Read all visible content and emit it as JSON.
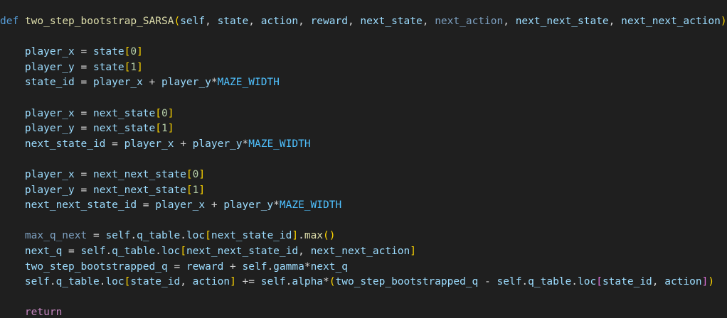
{
  "editor": {
    "language": "python",
    "colors": {
      "background": "#1f1f1f",
      "keyword": "#569cd6",
      "function": "#dcdcaa",
      "variable": "#9cdcfe",
      "constant": "#4fc1ff",
      "number": "#b5cea8",
      "bracket_level1": "#ffd700",
      "bracket_level2": "#da70d6",
      "bracket_level3": "#179fff",
      "control": "#c586c0",
      "text": "#d4d4d4"
    },
    "lines": [
      {
        "tokens": [
          {
            "t": "def",
            "c": "kw"
          },
          {
            "t": " ",
            "c": "plain"
          },
          {
            "t": "two_step_bootstrap_SARSA",
            "c": "fn"
          },
          {
            "t": "(",
            "c": "br1"
          },
          {
            "t": "self",
            "c": "param"
          },
          {
            "t": ", ",
            "c": "plain"
          },
          {
            "t": "state",
            "c": "param"
          },
          {
            "t": ", ",
            "c": "plain"
          },
          {
            "t": "action",
            "c": "param"
          },
          {
            "t": ", ",
            "c": "plain"
          },
          {
            "t": "reward",
            "c": "param"
          },
          {
            "t": ", ",
            "c": "plain"
          },
          {
            "t": "next_state",
            "c": "param"
          },
          {
            "t": ", ",
            "c": "plain"
          },
          {
            "t": "next_action",
            "c": "param-dim"
          },
          {
            "t": ", ",
            "c": "plain"
          },
          {
            "t": "next_next_state",
            "c": "param"
          },
          {
            "t": ", ",
            "c": "plain"
          },
          {
            "t": "next_next_action",
            "c": "param"
          },
          {
            "t": ")",
            "c": "br1"
          },
          {
            "t": ":",
            "c": "plain"
          }
        ]
      },
      {
        "tokens": []
      },
      {
        "tokens": [
          {
            "t": "    ",
            "c": "plain"
          },
          {
            "t": "player_x",
            "c": "var"
          },
          {
            "t": " = ",
            "c": "op"
          },
          {
            "t": "state",
            "c": "var"
          },
          {
            "t": "[",
            "c": "br1"
          },
          {
            "t": "0",
            "c": "num"
          },
          {
            "t": "]",
            "c": "br1"
          }
        ]
      },
      {
        "tokens": [
          {
            "t": "    ",
            "c": "plain"
          },
          {
            "t": "player_y",
            "c": "var"
          },
          {
            "t": " = ",
            "c": "op"
          },
          {
            "t": "state",
            "c": "var"
          },
          {
            "t": "[",
            "c": "br1"
          },
          {
            "t": "1",
            "c": "num"
          },
          {
            "t": "]",
            "c": "br1"
          }
        ]
      },
      {
        "tokens": [
          {
            "t": "    ",
            "c": "plain"
          },
          {
            "t": "state_id",
            "c": "var"
          },
          {
            "t": " = ",
            "c": "op"
          },
          {
            "t": "player_x",
            "c": "var"
          },
          {
            "t": " + ",
            "c": "op"
          },
          {
            "t": "player_y",
            "c": "var"
          },
          {
            "t": "*",
            "c": "op"
          },
          {
            "t": "MAZE_WIDTH",
            "c": "const"
          }
        ]
      },
      {
        "tokens": []
      },
      {
        "tokens": [
          {
            "t": "    ",
            "c": "plain"
          },
          {
            "t": "player_x",
            "c": "var"
          },
          {
            "t": " = ",
            "c": "op"
          },
          {
            "t": "next_state",
            "c": "var"
          },
          {
            "t": "[",
            "c": "br1"
          },
          {
            "t": "0",
            "c": "num"
          },
          {
            "t": "]",
            "c": "br1"
          }
        ]
      },
      {
        "tokens": [
          {
            "t": "    ",
            "c": "plain"
          },
          {
            "t": "player_y",
            "c": "var"
          },
          {
            "t": " = ",
            "c": "op"
          },
          {
            "t": "next_state",
            "c": "var"
          },
          {
            "t": "[",
            "c": "br1"
          },
          {
            "t": "1",
            "c": "num"
          },
          {
            "t": "]",
            "c": "br1"
          }
        ]
      },
      {
        "tokens": [
          {
            "t": "    ",
            "c": "plain"
          },
          {
            "t": "next_state_id",
            "c": "var"
          },
          {
            "t": " = ",
            "c": "op"
          },
          {
            "t": "player_x",
            "c": "var"
          },
          {
            "t": " + ",
            "c": "op"
          },
          {
            "t": "player_y",
            "c": "var"
          },
          {
            "t": "*",
            "c": "op"
          },
          {
            "t": "MAZE_WIDTH",
            "c": "const"
          }
        ]
      },
      {
        "tokens": []
      },
      {
        "tokens": [
          {
            "t": "    ",
            "c": "plain"
          },
          {
            "t": "player_x",
            "c": "var"
          },
          {
            "t": " = ",
            "c": "op"
          },
          {
            "t": "next_next_state",
            "c": "var"
          },
          {
            "t": "[",
            "c": "br1"
          },
          {
            "t": "0",
            "c": "num"
          },
          {
            "t": "]",
            "c": "br1"
          }
        ]
      },
      {
        "tokens": [
          {
            "t": "    ",
            "c": "plain"
          },
          {
            "t": "player_y",
            "c": "var"
          },
          {
            "t": " = ",
            "c": "op"
          },
          {
            "t": "next_next_state",
            "c": "var"
          },
          {
            "t": "[",
            "c": "br1"
          },
          {
            "t": "1",
            "c": "num"
          },
          {
            "t": "]",
            "c": "br1"
          }
        ]
      },
      {
        "tokens": [
          {
            "t": "    ",
            "c": "plain"
          },
          {
            "t": "next_next_state_id",
            "c": "var"
          },
          {
            "t": " = ",
            "c": "op"
          },
          {
            "t": "player_x",
            "c": "var"
          },
          {
            "t": " + ",
            "c": "op"
          },
          {
            "t": "player_y",
            "c": "var"
          },
          {
            "t": "*",
            "c": "op"
          },
          {
            "t": "MAZE_WIDTH",
            "c": "const"
          }
        ]
      },
      {
        "tokens": []
      },
      {
        "tokens": [
          {
            "t": "    ",
            "c": "plain"
          },
          {
            "t": "max_q_next",
            "c": "var-dim"
          },
          {
            "t": " = ",
            "c": "op"
          },
          {
            "t": "self",
            "c": "var"
          },
          {
            "t": ".",
            "c": "op"
          },
          {
            "t": "q_table",
            "c": "var"
          },
          {
            "t": ".",
            "c": "op"
          },
          {
            "t": "loc",
            "c": "var"
          },
          {
            "t": "[",
            "c": "br1"
          },
          {
            "t": "next_state_id",
            "c": "var"
          },
          {
            "t": "]",
            "c": "br1"
          },
          {
            "t": ".",
            "c": "op"
          },
          {
            "t": "max",
            "c": "fn"
          },
          {
            "t": "()",
            "c": "br1"
          }
        ]
      },
      {
        "tokens": [
          {
            "t": "    ",
            "c": "plain"
          },
          {
            "t": "next_q",
            "c": "var"
          },
          {
            "t": " = ",
            "c": "op"
          },
          {
            "t": "self",
            "c": "var"
          },
          {
            "t": ".",
            "c": "op"
          },
          {
            "t": "q_table",
            "c": "var"
          },
          {
            "t": ".",
            "c": "op"
          },
          {
            "t": "loc",
            "c": "var"
          },
          {
            "t": "[",
            "c": "br1"
          },
          {
            "t": "next_next_state_id",
            "c": "var"
          },
          {
            "t": ", ",
            "c": "plain"
          },
          {
            "t": "next_next_action",
            "c": "var"
          },
          {
            "t": "]",
            "c": "br1"
          }
        ]
      },
      {
        "tokens": [
          {
            "t": "    ",
            "c": "plain"
          },
          {
            "t": "two_step_bootstrapped_q",
            "c": "var"
          },
          {
            "t": " = ",
            "c": "op"
          },
          {
            "t": "reward",
            "c": "var"
          },
          {
            "t": " + ",
            "c": "op"
          },
          {
            "t": "self",
            "c": "var"
          },
          {
            "t": ".",
            "c": "op"
          },
          {
            "t": "gamma",
            "c": "var"
          },
          {
            "t": "*",
            "c": "op"
          },
          {
            "t": "next_q",
            "c": "var"
          }
        ]
      },
      {
        "tokens": [
          {
            "t": "    ",
            "c": "plain"
          },
          {
            "t": "self",
            "c": "var"
          },
          {
            "t": ".",
            "c": "op"
          },
          {
            "t": "q_table",
            "c": "var"
          },
          {
            "t": ".",
            "c": "op"
          },
          {
            "t": "loc",
            "c": "var"
          },
          {
            "t": "[",
            "c": "br1"
          },
          {
            "t": "state_id",
            "c": "var"
          },
          {
            "t": ", ",
            "c": "plain"
          },
          {
            "t": "action",
            "c": "var"
          },
          {
            "t": "]",
            "c": "br1"
          },
          {
            "t": " += ",
            "c": "op"
          },
          {
            "t": "self",
            "c": "var"
          },
          {
            "t": ".",
            "c": "op"
          },
          {
            "t": "alpha",
            "c": "var"
          },
          {
            "t": "*",
            "c": "op"
          },
          {
            "t": "(",
            "c": "br1"
          },
          {
            "t": "two_step_bootstrapped_q",
            "c": "var"
          },
          {
            "t": " - ",
            "c": "op"
          },
          {
            "t": "self",
            "c": "var"
          },
          {
            "t": ".",
            "c": "op"
          },
          {
            "t": "q_table",
            "c": "var"
          },
          {
            "t": ".",
            "c": "op"
          },
          {
            "t": "loc",
            "c": "var"
          },
          {
            "t": "[",
            "c": "br2"
          },
          {
            "t": "state_id",
            "c": "var"
          },
          {
            "t": ", ",
            "c": "plain"
          },
          {
            "t": "action",
            "c": "var"
          },
          {
            "t": "]",
            "c": "br2"
          },
          {
            "t": ")",
            "c": "br1"
          }
        ]
      },
      {
        "tokens": []
      },
      {
        "tokens": [
          {
            "t": "    ",
            "c": "plain"
          },
          {
            "t": "return",
            "c": "ret"
          }
        ]
      }
    ]
  }
}
